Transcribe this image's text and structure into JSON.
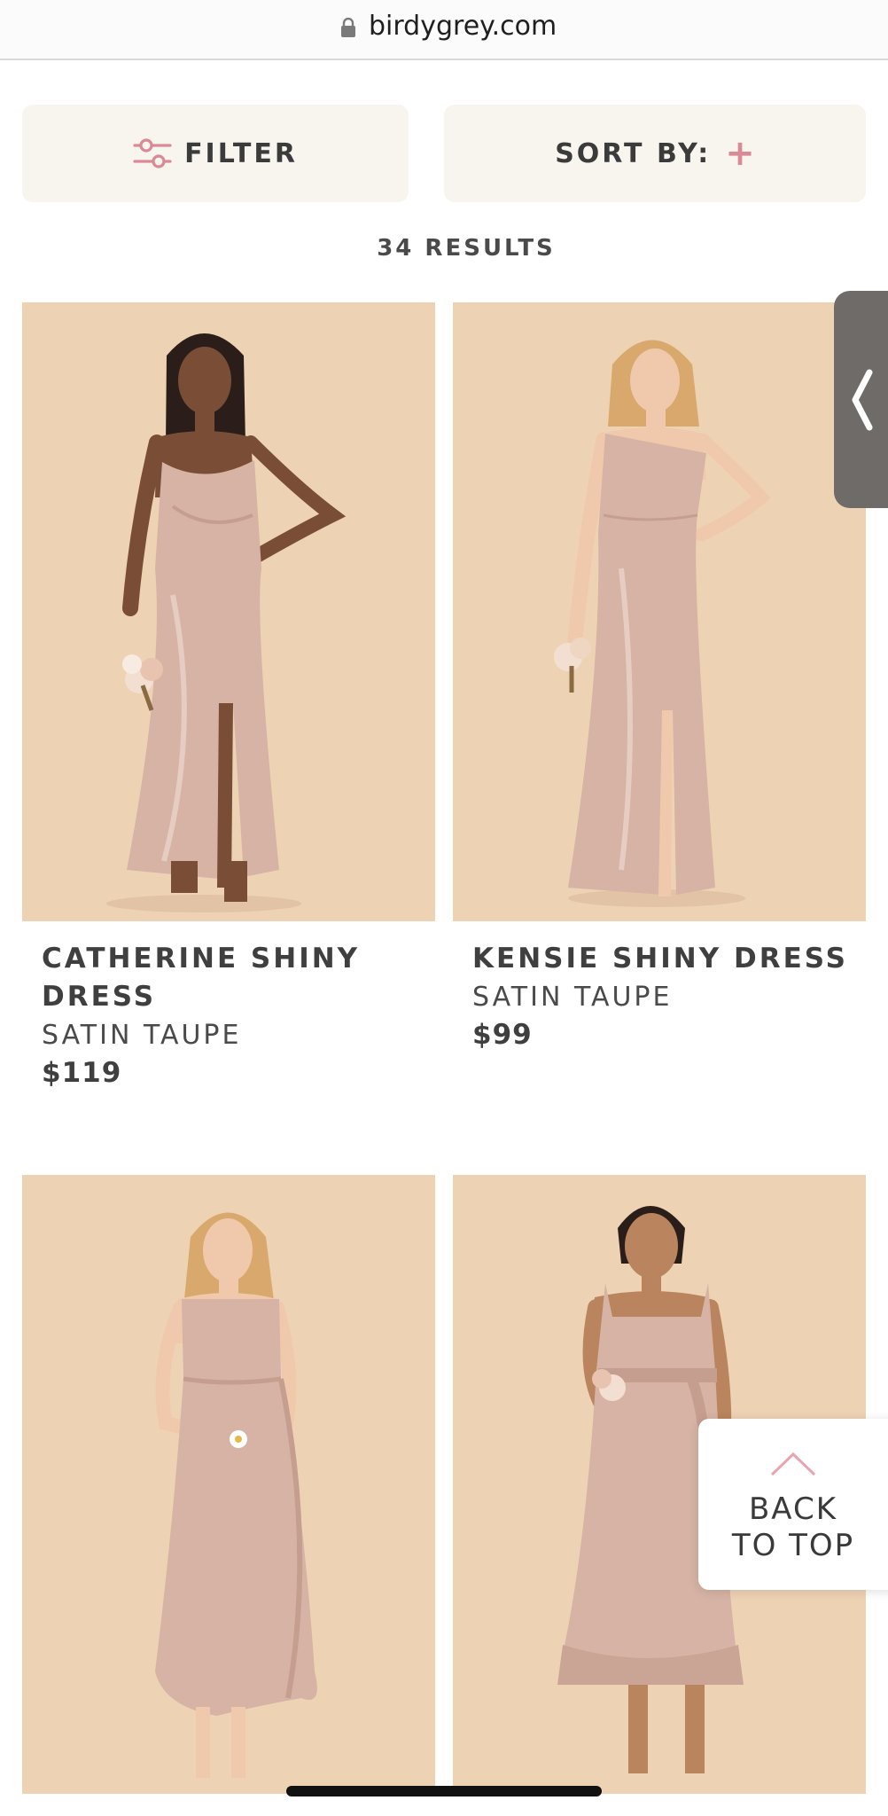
{
  "browser": {
    "url": "birdygrey.com",
    "lock_icon": "lock-icon"
  },
  "toolbar": {
    "filter_label": "FILTER",
    "filter_icon": "sliders-icon",
    "sort_label": "SORT BY:",
    "sort_icon": "plus-icon",
    "accent_color": "#d98a96"
  },
  "results": {
    "count_label": "34 RESULTS"
  },
  "products": [
    {
      "name": "CATHERINE SHINY DRESS",
      "color": "SATIN TAUPE",
      "price": "$119"
    },
    {
      "name": "KENSIE SHINY DRESS",
      "color": "SATIN TAUPE",
      "price": "$99"
    },
    {
      "name": "",
      "color": "",
      "price": ""
    },
    {
      "name": "",
      "color": "",
      "price": ""
    }
  ],
  "side_tab": {
    "icon": "chevron-left-icon"
  },
  "back_to_top": {
    "icon": "chevron-up-icon",
    "label_line1": "BACK",
    "label_line2": "TO TOP"
  },
  "colors": {
    "image_background": "#eed2b4",
    "button_background": "#f8f4ee",
    "dress": "#d6b3a4"
  }
}
